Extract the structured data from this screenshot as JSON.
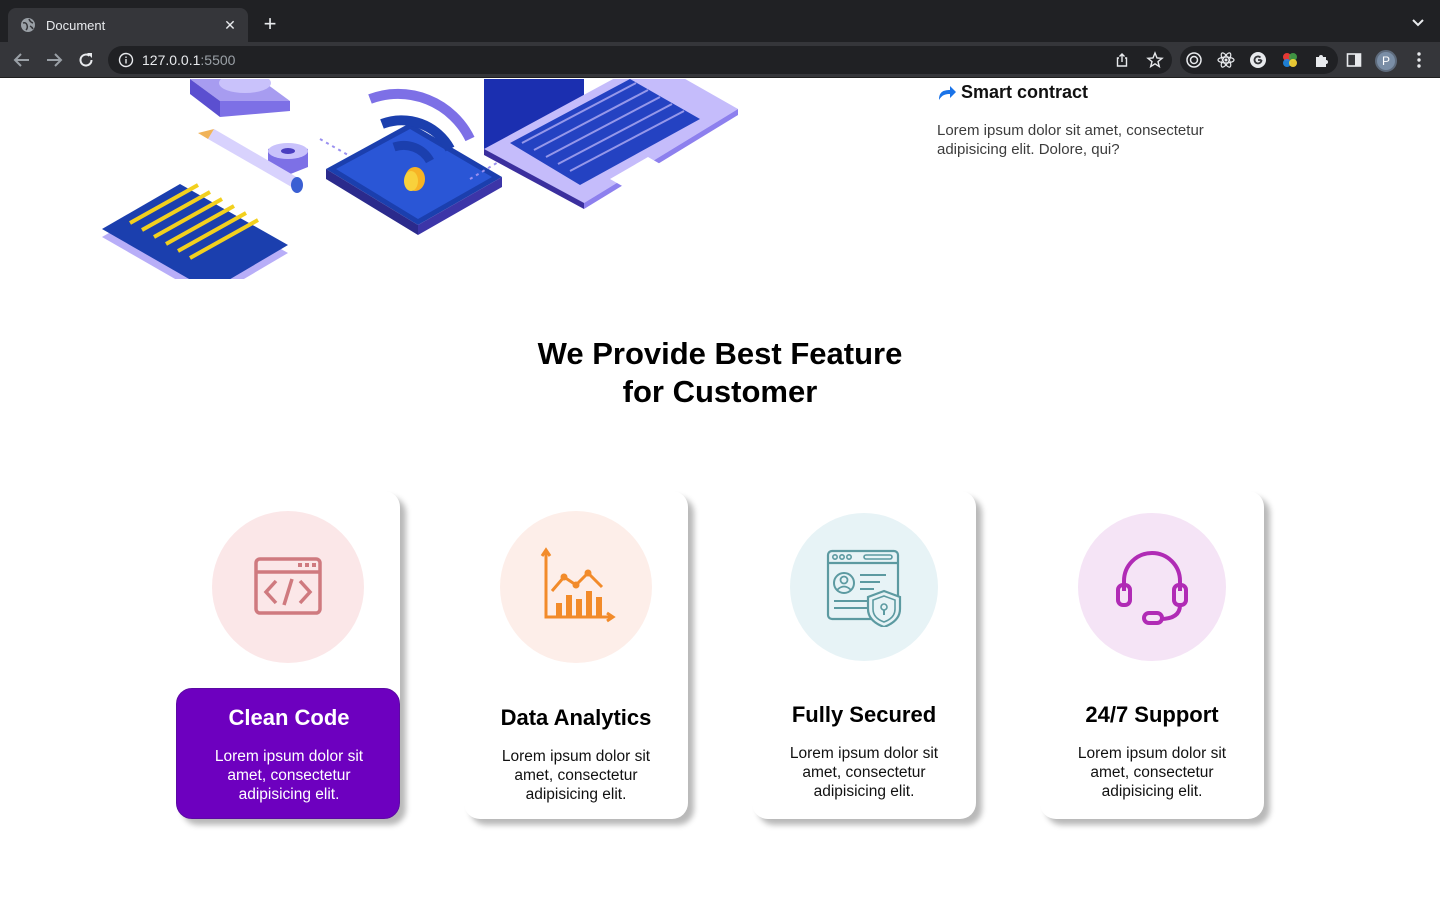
{
  "browser": {
    "tab_title": "Document",
    "url_host": "127.0.0.1",
    "url_port": ":5500",
    "avatar_initial": "P"
  },
  "page": {
    "feature_item": {
      "title": "Smart contract",
      "description": "Lorem ipsum dolor sit amet, consectetur adipisicing elit. Dolore, qui?"
    },
    "section_title_line1": "We Provide Best Feature",
    "section_title_line2": "for Customer",
    "cards": [
      {
        "title": "Clean Code",
        "description": "Lorem ipsum dolor sit amet, consectetur adipisicing elit.",
        "icon": "code-window-icon",
        "active": true
      },
      {
        "title": "Data Analytics",
        "description": "Lorem ipsum dolor sit amet, consectetur adipisicing elit.",
        "icon": "analytics-chart-icon",
        "active": false
      },
      {
        "title": "Fully Secured",
        "description": "Lorem ipsum dolor sit amet, consectetur adipisicing elit.",
        "icon": "secured-profile-icon",
        "active": false
      },
      {
        "title": "24/7 Support",
        "description": "Lorem ipsum dolor sit amet, consectetur adipisicing elit.",
        "icon": "headset-icon",
        "active": false
      }
    ]
  },
  "colors": {
    "active_card": "#6d00bf",
    "clean_code_circle": "#fbe7e8",
    "analytics_circle": "#fdeee9",
    "secured_circle": "#e7f3f6",
    "support_circle": "#f5e4f6"
  }
}
